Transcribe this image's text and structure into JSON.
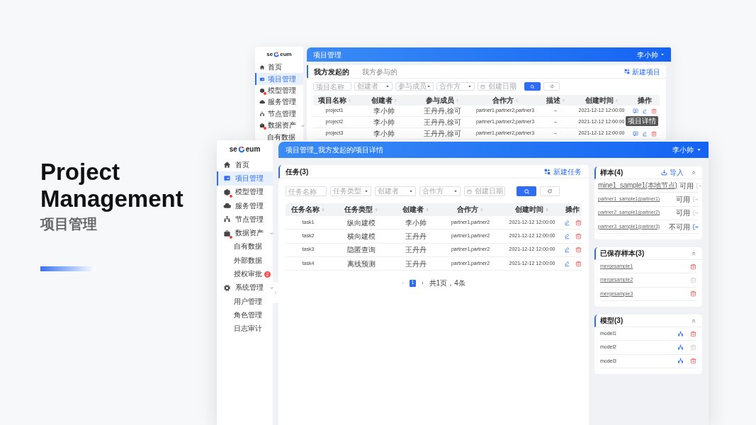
{
  "hero": {
    "title": "Project Management",
    "subtitle": "项目管理"
  },
  "back_window": {
    "logo": {
      "left": "se",
      "right": "eum"
    },
    "sidebar": [
      {
        "label": "首页",
        "selected": false
      },
      {
        "label": "项目管理",
        "selected": true
      },
      {
        "label": "模型管理",
        "selected": false,
        "alert": true
      },
      {
        "label": "服务管理",
        "selected": false
      },
      {
        "label": "节点管理",
        "selected": false
      },
      {
        "label": "数据资产",
        "selected": false,
        "alert": true,
        "expanded": true,
        "children": [
          {
            "label": "自有数据",
            "selected": false
          }
        ]
      }
    ],
    "header": {
      "title": "项目管理",
      "user": "李小帅"
    },
    "tabs": [
      {
        "label": "我方发起的",
        "selected": true
      },
      {
        "label": "我方参与的",
        "selected": false
      }
    ],
    "new_button": "新建项目",
    "filters": [
      {
        "kind": "input",
        "placeholder": "项目名称"
      },
      {
        "kind": "select",
        "placeholder": "创建者"
      },
      {
        "kind": "select",
        "placeholder": "参与成员"
      },
      {
        "kind": "select",
        "placeholder": "合作方"
      },
      {
        "kind": "date",
        "placeholder": "创建日期"
      }
    ],
    "table": {
      "columns": [
        "项目名称",
        "创建者",
        "参与成员",
        "合作方",
        "描述",
        "创建时间",
        "操作"
      ],
      "rows": [
        [
          "project1",
          "李小帅",
          "王丹丹,徐可",
          "partner1,partner2,partner3",
          "–",
          "2021-12-12 12:00:00"
        ],
        [
          "project2",
          "李小帅",
          "王丹丹,徐可",
          "partner1,partner2,partner3",
          "–",
          "2021-12-12 12:00:00"
        ],
        [
          "project3",
          "李小帅",
          "王丹丹,徐可",
          "partner1,partner2,partner3",
          "–",
          "2021-12-12 12:00:00"
        ]
      ]
    },
    "tooltip": "项目详情"
  },
  "front_window": {
    "logo": {
      "left": "se",
      "right": "eum"
    },
    "sidebar": [
      {
        "label": "首页",
        "selected": false
      },
      {
        "label": "项目管理",
        "selected": true
      },
      {
        "label": "模型管理",
        "selected": false,
        "alert": true
      },
      {
        "label": "服务管理",
        "selected": false
      },
      {
        "label": "节点管理",
        "selected": false
      },
      {
        "label": "数据资产",
        "selected": false,
        "alert": true,
        "expanded": true,
        "children": [
          {
            "label": "自有数据",
            "selected": false
          },
          {
            "label": "外部数据",
            "selected": false
          },
          {
            "label": "授权审批",
            "selected": false,
            "badge": "2"
          }
        ]
      },
      {
        "label": "系统管理",
        "selected": false,
        "expanded": true,
        "children": [
          {
            "label": "用户管理",
            "selected": false
          },
          {
            "label": "角色管理",
            "selected": false
          },
          {
            "label": "日志审计",
            "selected": false
          }
        ]
      }
    ],
    "header": {
      "breadcrumb": "项目管理_我方发起的/项目详情",
      "user": "李小帅"
    },
    "tasks": {
      "title": "任务(3)",
      "new_button": "新建任务",
      "filters": [
        {
          "kind": "input",
          "placeholder": "任务名称"
        },
        {
          "kind": "select",
          "placeholder": "任务类型"
        },
        {
          "kind": "select",
          "placeholder": "创建者"
        },
        {
          "kind": "select",
          "placeholder": "合作方"
        },
        {
          "kind": "date",
          "placeholder": "创建日期"
        }
      ],
      "table": {
        "columns": [
          "任务名称",
          "任务类型",
          "创建者",
          "合作方",
          "创建时间",
          "操作"
        ],
        "rows": [
          [
            "task1",
            "纵向建模",
            "李小帅",
            "partner1,partner2",
            "2021-12-12 12:00:00"
          ],
          [
            "task2",
            "横向建模",
            "王丹丹",
            "partner1,partner2",
            "2021-12-12 12:00:00"
          ],
          [
            "task3",
            "隐匿查询",
            "王丹丹",
            "partner1,partner2",
            "2021-12-12 12:00:00"
          ],
          [
            "task4",
            "离线预测",
            "王丹丹",
            "partner1,partner2",
            "2021-12-12 12:00:00"
          ]
        ]
      },
      "pagination": {
        "prev": "‹",
        "pages": [
          {
            "label": "1",
            "selected": true
          }
        ],
        "next": "›",
        "summary": "共1页，4条"
      }
    },
    "samples": {
      "title": "样本(4)",
      "import_button": "导入",
      "items": [
        {
          "name": "mine1_sample1(本地节点)",
          "status": "可用",
          "action_enabled": false
        },
        {
          "name": "partner1_sample1(partner1)",
          "status": "可用",
          "action_enabled": false
        },
        {
          "name": "partner2_sample1(partner2)",
          "status": "可用",
          "action_enabled": false
        },
        {
          "name": "partner3_sample1(partner3)",
          "status": "不可用",
          "action_enabled": true
        }
      ]
    },
    "saved_samples": {
      "title": "已保存样本(3)",
      "items": [
        {
          "name": "mergesample1",
          "delete_enabled": true
        },
        {
          "name": "mergesample2",
          "delete_enabled": false
        },
        {
          "name": "mergesample3",
          "delete_enabled": true
        }
      ]
    },
    "models": {
      "title": "模型(3)",
      "items": [
        {
          "name": "model1",
          "delete_enabled": true
        },
        {
          "name": "model2",
          "delete_enabled": false
        },
        {
          "name": "model3",
          "delete_enabled": true
        }
      ]
    }
  }
}
